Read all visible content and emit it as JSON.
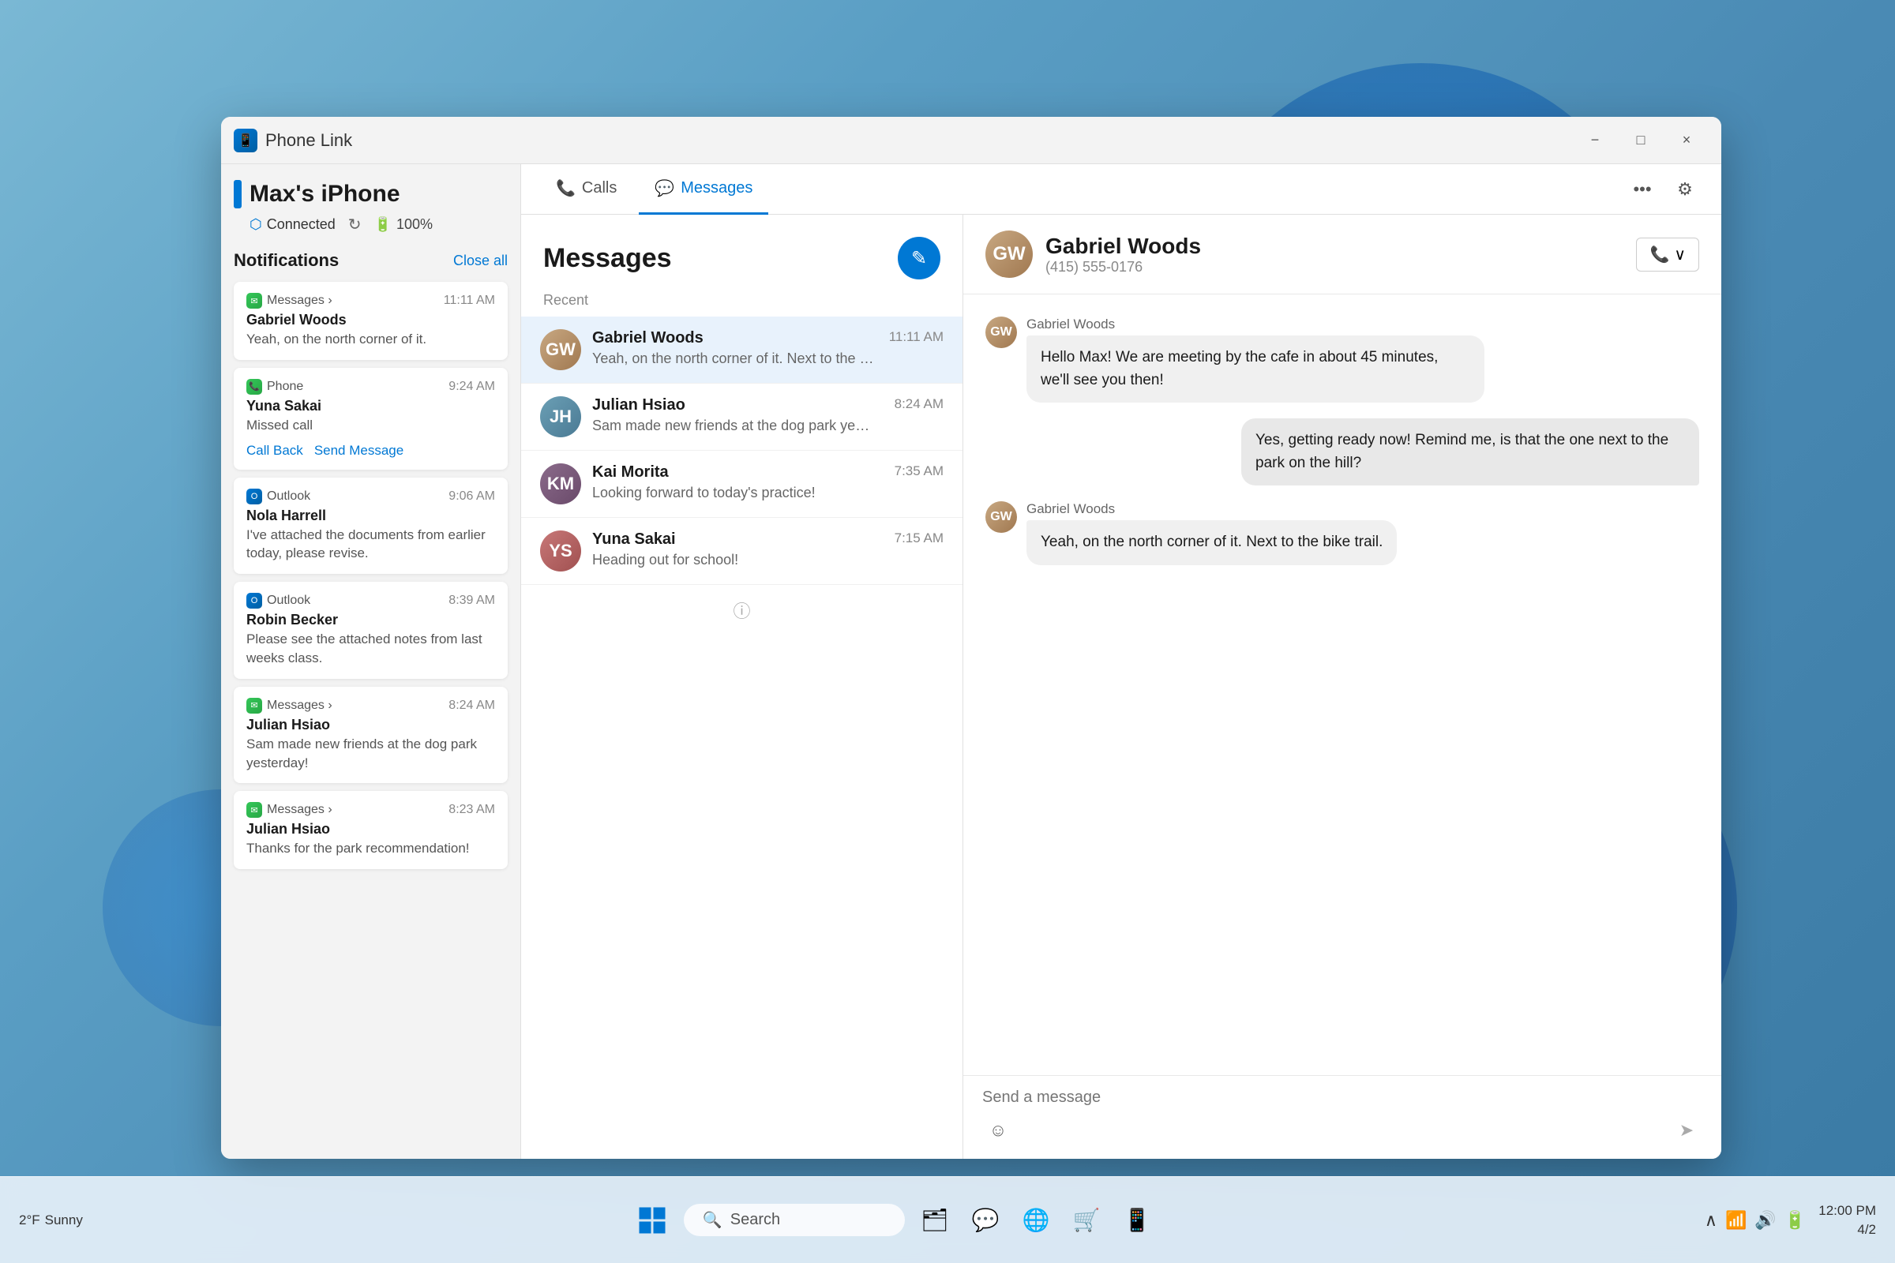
{
  "app": {
    "title": "Phone Link",
    "device_name": "Max's iPhone",
    "connection_status": "Connected",
    "battery": "100%"
  },
  "titlebar": {
    "minimize": "−",
    "maximize": "□",
    "close": "×"
  },
  "tabs": {
    "calls": "Calls",
    "messages": "Messages"
  },
  "notifications": {
    "title": "Notifications",
    "close_all": "Close all",
    "items": [
      {
        "app": "Messages",
        "app_type": "messages",
        "time": "11:11 AM",
        "sender": "Gabriel Woods",
        "message": "Yeah, on the north corner of it.",
        "arrow": "›"
      },
      {
        "app": "Phone",
        "app_type": "phone",
        "time": "9:24 AM",
        "sender": "Yuna Sakai",
        "message": "Missed call",
        "actions": [
          "Call Back",
          "Send Message"
        ]
      },
      {
        "app": "Outlook",
        "app_type": "outlook",
        "time": "9:06 AM",
        "sender": "Nola Harrell",
        "message": "I've attached the documents from earlier today, please revise."
      },
      {
        "app": "Outlook",
        "app_type": "outlook",
        "time": "8:39 AM",
        "sender": "Robin Becker",
        "message": "Please see the attached notes from last weeks class."
      },
      {
        "app": "Messages",
        "app_type": "messages",
        "time": "8:24 AM",
        "sender": "Julian Hsiao",
        "message": "Sam made new friends at the dog park yesterday!",
        "arrow": "›"
      },
      {
        "app": "Messages",
        "app_type": "messages",
        "time": "8:23 AM",
        "sender": "Julian Hsiao",
        "message": "Thanks for the park recommendation!",
        "arrow": "›"
      }
    ]
  },
  "messages": {
    "title": "Messages",
    "recent_label": "Recent",
    "compose_icon": "✎",
    "items": [
      {
        "id": 1,
        "name": "Gabriel Woods",
        "time": "11:11 AM",
        "preview": "Yeah, on the north corner of it. Next to the bike trail.",
        "active": true,
        "avatar_initials": "GW",
        "avatar_class": "avatar-gabriel"
      },
      {
        "id": 2,
        "name": "Julian Hsiao",
        "time": "8:24 AM",
        "preview": "Sam made new friends at the dog park yesterday!",
        "active": false,
        "avatar_initials": "JH",
        "avatar_class": "avatar-julian"
      },
      {
        "id": 3,
        "name": "Kai Morita",
        "time": "7:35 AM",
        "preview": "Looking forward to today's practice!",
        "active": false,
        "avatar_initials": "KM",
        "avatar_class": "avatar-kai"
      },
      {
        "id": 4,
        "name": "Yuna Sakai",
        "time": "7:15 AM",
        "preview": "Heading out for school!",
        "active": false,
        "avatar_initials": "YS",
        "avatar_class": "avatar-yuna"
      }
    ]
  },
  "chat": {
    "contact_name": "Gabriel Woods",
    "contact_phone": "(415) 555-0176",
    "avatar_initials": "GW",
    "messages": [
      {
        "type": "incoming",
        "sender": "Gabriel Woods",
        "text": "Hello Max! We are meeting by the cafe in about 45 minutes, we'll see you then!"
      },
      {
        "type": "outgoing",
        "text": "Yes, getting ready now! Remind me, is that the one next to the park on the hill?"
      },
      {
        "type": "incoming",
        "sender": "Gabriel Woods",
        "text": "Yeah, on the north corner of it. Next to the bike trail."
      }
    ],
    "input_placeholder": "Send a message",
    "emoji_icon": "☺",
    "send_icon": "➤"
  },
  "taskbar": {
    "weather": "2°F",
    "condition": "Sunny",
    "search_placeholder": "Search",
    "time": "4/2",
    "icons": [
      "📁",
      "🌐",
      "💬",
      "📁",
      "🦊",
      "🔷",
      "🛒"
    ]
  }
}
